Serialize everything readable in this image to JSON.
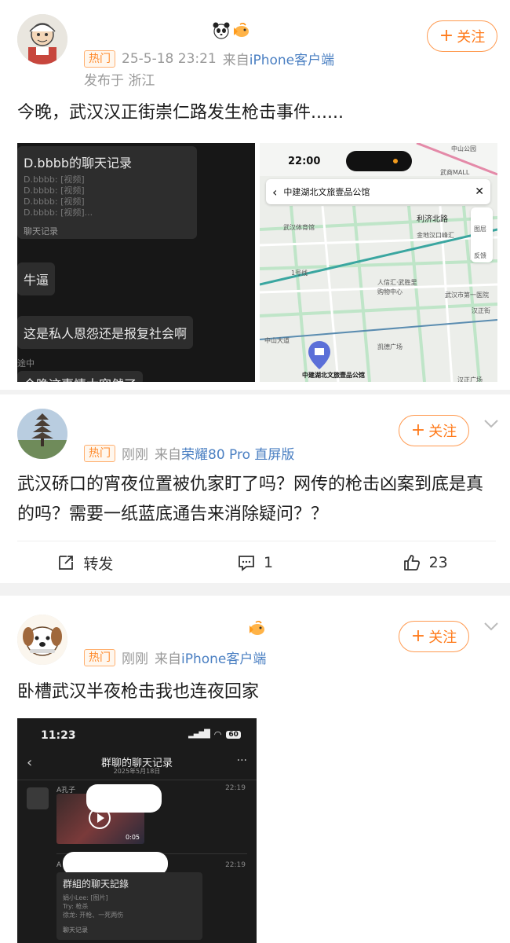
{
  "colors": {
    "accent": "#ff7a1a",
    "hot": "#ff8a2b",
    "link": "#4a7fc2",
    "meta": "#999999"
  },
  "common": {
    "follow_label": "关注",
    "follow_plus": "+",
    "hot_label": "热门"
  },
  "post1": {
    "date": "25-5-18 23:21",
    "source_prefix": "来自",
    "source": "iPhone客户端",
    "location": "发布于 浙江",
    "text": "今晚，武汉汉正街崇仁路发生枪击事件......",
    "badges": [
      "panda-badge-icon",
      "fish-badge-icon"
    ],
    "image_left": {
      "card_title": "D.bbbb的聊天记录",
      "card_lines": [
        "D.bbbb: [视频]",
        "D.bbbb: [视频]",
        "D.bbbb: [视频]",
        "D.bbbb: [视频]..."
      ],
      "card_footer": "聊天记录",
      "msg1": "牛逼",
      "msg2": "这是私人恩怨还是报复社会啊",
      "side_text": "途中",
      "cut_text": "今晚这事情太突然了"
    },
    "image_right": {
      "time": "22:00",
      "search_text": "中建湖北文旅壹品公馆",
      "labels": {
        "park": "中山公园",
        "mall": "武商MALL",
        "station_road": "利济北路",
        "stadium": "武汉体育馆",
        "hanzheng": "汉正街",
        "jinxiu": "金地汉口峰汇",
        "wushi": "武汉市第一医院",
        "renxin": "人信汇·武胜里",
        "shopping": "购物中心",
        "kaide": "凯德广场",
        "target": "中建湖北文旅壹品公馆",
        "side1": "图层",
        "side2": "反馈",
        "hanzheng_square": "汉正广场",
        "line_no": "1号线",
        "road_big": "中山大道"
      }
    }
  },
  "post2": {
    "time": "刚刚",
    "source_prefix": "来自",
    "source": "荣耀80 Pro 直屏版",
    "text": "武汉硚口的宵夜位置被仇家盯了吗？网传的枪击凶案到底是真的吗？需要一纸蓝底通告来消除疑问？？",
    "repost_label": "转发",
    "comment_count": "1",
    "like_count": "23"
  },
  "post3": {
    "time": "刚刚",
    "source_prefix": "来自",
    "source": "iPhone客户端",
    "text": "卧槽武汉半夜枪击我也连夜回家",
    "badges": [
      "fish-badge-icon"
    ],
    "image": {
      "status_time": "11:23",
      "battery": "60",
      "chat_title": "群聊的聊天记录",
      "chat_date": "2025年5月18日",
      "sender1": "A孔子",
      "time1": "22:19",
      "video_dur": "0:05",
      "sender2": "A",
      "time2": "22:19",
      "card_title": "群組的聊天記錄",
      "card_lines": [
        "娟小Lee: [图片]",
        "Try: 枪杀",
        "徐龙: 开枪、一死两伤"
      ],
      "card_footer": "聊天记录"
    }
  }
}
